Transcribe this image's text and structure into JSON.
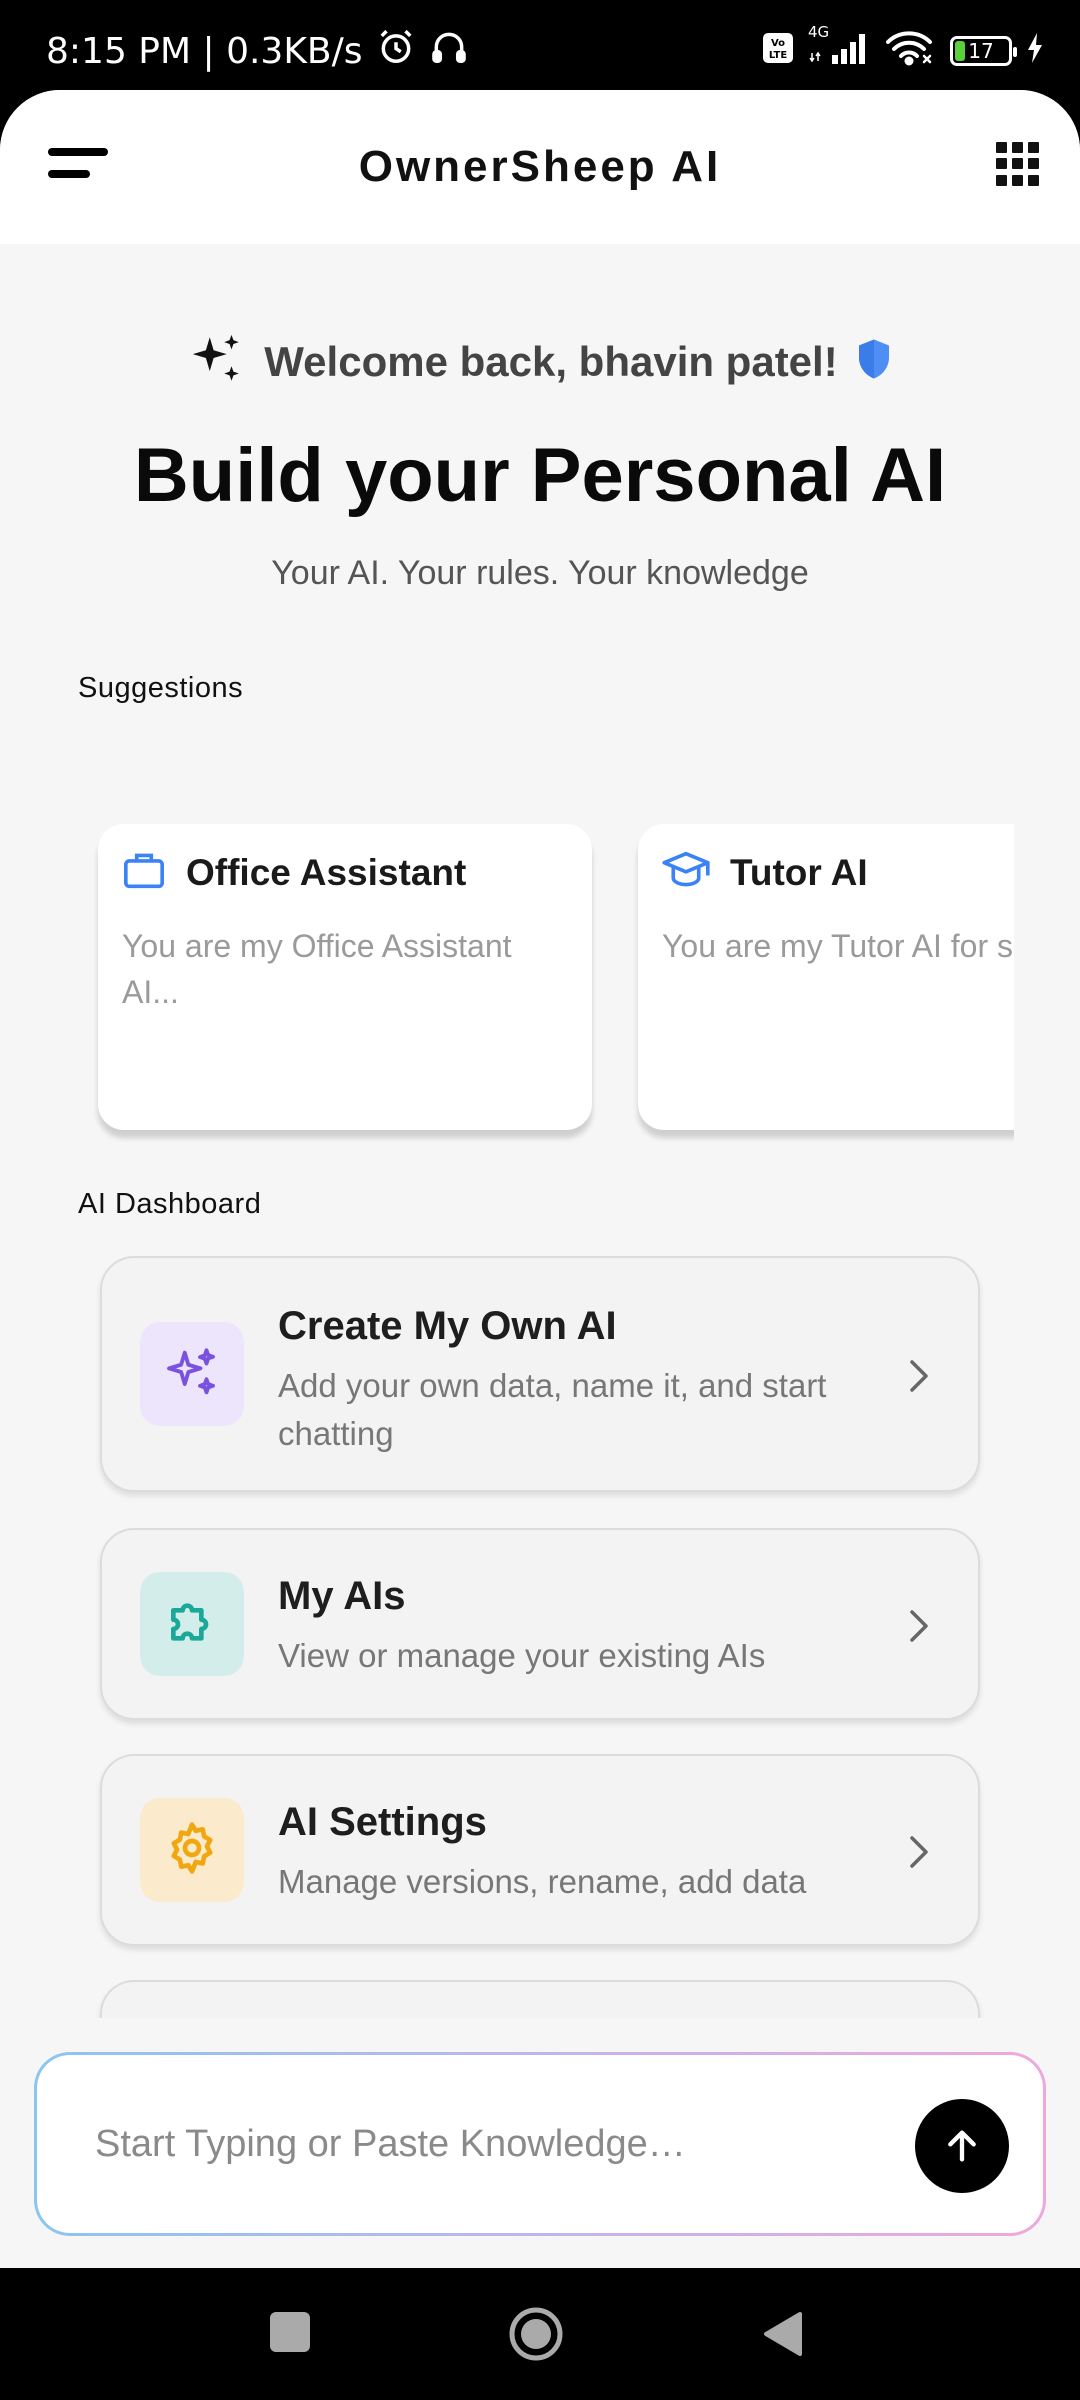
{
  "status_bar": {
    "time_speed": "8:15 PM | 0.3KB/s",
    "network_label": "4G",
    "volte_label": "Vo LTE",
    "battery_level": "17"
  },
  "header": {
    "title": "OwnerSheep AI"
  },
  "welcome": {
    "text": "Welcome back, bhavin patel!"
  },
  "hero": {
    "title": "Build your Personal AI",
    "subtitle": "Your AI. Your rules. Your knowledge"
  },
  "suggestions": {
    "label": "Suggestions",
    "items": [
      {
        "title": "Office Assistant",
        "description": "You are my Office Assistant\nAI...",
        "icon": "briefcase-icon"
      },
      {
        "title": "Tutor AI",
        "description": "You are my Tutor AI for\nschool and college stud",
        "icon": "graduation-cap-icon"
      }
    ]
  },
  "dashboard": {
    "label": "AI Dashboard",
    "items": [
      {
        "title": "Create My Own AI",
        "description": "Add your own data, name it, and start chatting",
        "icon": "sparkles-icon",
        "icon_bg": "#ece5fb",
        "icon_color": "#7a52e0"
      },
      {
        "title": "My AIs",
        "description": "View or manage your existing AIs",
        "icon": "puzzle-icon",
        "icon_bg": "#d3eeea",
        "icon_color": "#1aa898"
      },
      {
        "title": "AI Settings",
        "description": "Manage versions, rename, add data",
        "icon": "gear-icon",
        "icon_bg": "#fbeacc",
        "icon_color": "#f1a710"
      }
    ]
  },
  "composer": {
    "placeholder": "Start Typing or Paste Knowledge…"
  },
  "colors": {
    "accent_blue": "#3b82f6",
    "shield_blue": "#4f8ff5"
  }
}
